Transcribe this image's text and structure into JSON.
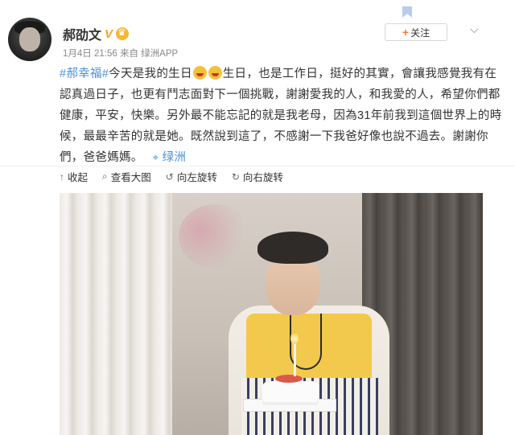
{
  "author": {
    "name": "郝劭文",
    "verified_badge": "V",
    "meta": "1月4日 21:56 来自 绿洲APP"
  },
  "follow_button": {
    "plus": "+",
    "label": "关注"
  },
  "post": {
    "topic": "#郝幸福#",
    "text_before_emoji": "今天是我的生日",
    "text_after_emoji": "生日，也是工作日，挺好的其實，會讓我感覺我有在認真過日子，也更有鬥志面對下一個挑戰，謝謝愛我的人，和我愛的人，希望你們都健康，平安，快樂。另外最不能忘記的就是我老母，因為31年前我到這個世界上的時候，最最辛苦的就是她。既然說到這了，不感謝一下我爸好像也說不過去。謝謝你們，爸爸媽媽。",
    "location_label": "绿洲"
  },
  "toolbar": {
    "collapse": "收起",
    "view_large": "查看大图",
    "rotate_left": "向左旋转",
    "rotate_right": "向右旋转"
  },
  "icons": {
    "collapse": "up-arrow-icon",
    "view_large": "magnifier-icon",
    "rotate_left": "rotate-left-icon",
    "rotate_right": "rotate-right-icon",
    "location": "location-pin-icon",
    "more": "chevron-down-icon",
    "bookmark": "bookmark-icon"
  },
  "colors": {
    "link": "#4a90d9",
    "follow_plus": "#f77c3d",
    "vip": "#f5a623"
  }
}
